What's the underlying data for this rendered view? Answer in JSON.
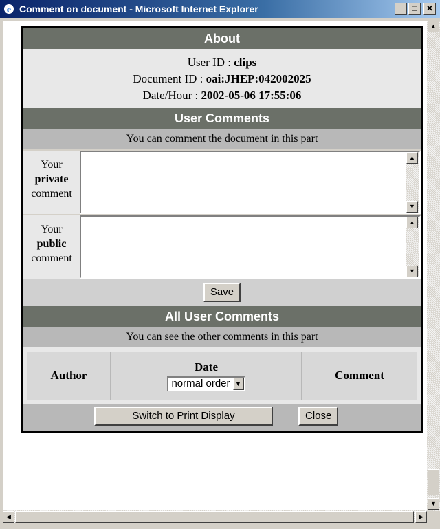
{
  "window": {
    "title": "Comment on document - Microsoft Internet Explorer"
  },
  "about": {
    "heading": "About",
    "user_id_label": "User ID : ",
    "user_id": "clips",
    "document_id_label": "Document ID : ",
    "document_id": "oai:JHEP:042002025",
    "date_label": "Date/Hour : ",
    "date": "2002-05-06 17:55:06"
  },
  "user_comments": {
    "heading": "User Comments",
    "subheading": "You can comment the document in this part",
    "private_label": {
      "line1": "Your",
      "line2": "private",
      "line3": "comment"
    },
    "public_label": {
      "line1": "Your",
      "line2": "public",
      "line3": "comment"
    },
    "private_value": "",
    "public_value": "",
    "save_label": "Save"
  },
  "all_comments": {
    "heading": "All User Comments",
    "subheading": "You can see the other comments in this part",
    "columns": {
      "author": "Author",
      "date": "Date",
      "comment": "Comment"
    },
    "order_select": "normal order"
  },
  "footer": {
    "print_label": "Switch to Print Display",
    "close_label": "Close"
  },
  "icons": {
    "app": "internet-explorer-icon"
  }
}
